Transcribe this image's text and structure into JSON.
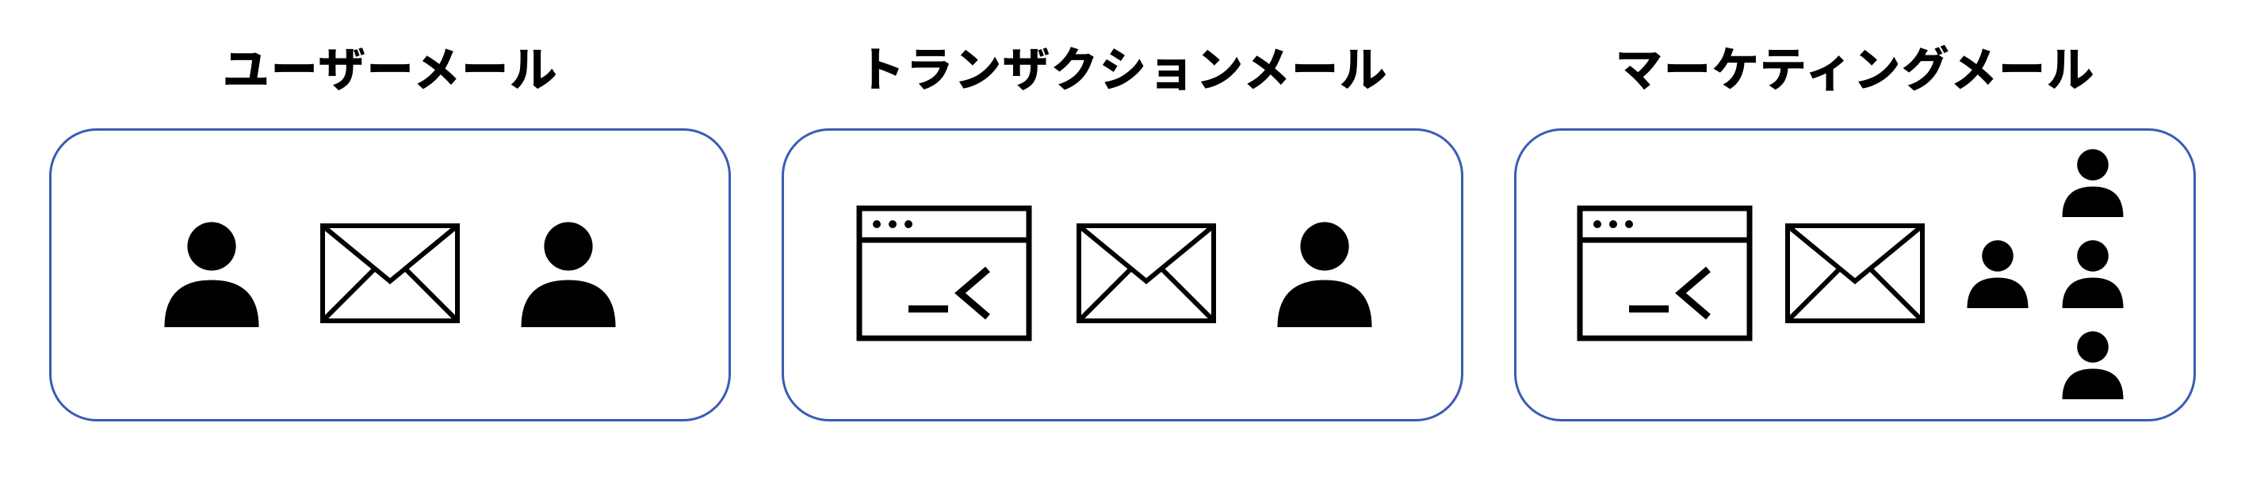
{
  "panels": [
    {
      "title": "ユーザーメール"
    },
    {
      "title": "トランザクションメール"
    },
    {
      "title": "マーケティングメール"
    }
  ],
  "icons": {
    "person": "person-icon",
    "envelope": "envelope-icon",
    "terminal": "terminal-window-icon"
  }
}
